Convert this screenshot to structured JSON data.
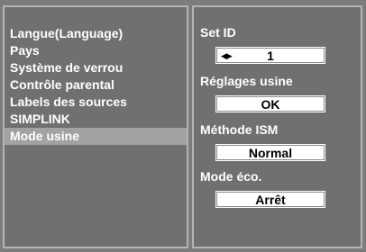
{
  "menu": {
    "items": [
      {
        "label": "Langue(Language)"
      },
      {
        "label": "Pays"
      },
      {
        "label": "Système de verrou"
      },
      {
        "label": "Contrôle parental"
      },
      {
        "label": "Labels des sources"
      },
      {
        "label": "SIMPLINK"
      },
      {
        "label": "Mode usine"
      }
    ],
    "selected_label": "Mode usine"
  },
  "settings": {
    "set_id": {
      "label": "Set ID",
      "value": "1",
      "arrows": "◀▶"
    },
    "reglages_usine": {
      "label": "Réglages usine",
      "value": "OK"
    },
    "methode_ism": {
      "label": "Méthode ISM",
      "value": "Normal"
    },
    "mode_eco": {
      "label": "Mode éco.",
      "value": "Arrêt"
    }
  },
  "colors": {
    "panel_bg": "#707070",
    "selected_bg": "#a2a2a2",
    "text": "#ffffff",
    "box_bg": "#ffffff"
  }
}
